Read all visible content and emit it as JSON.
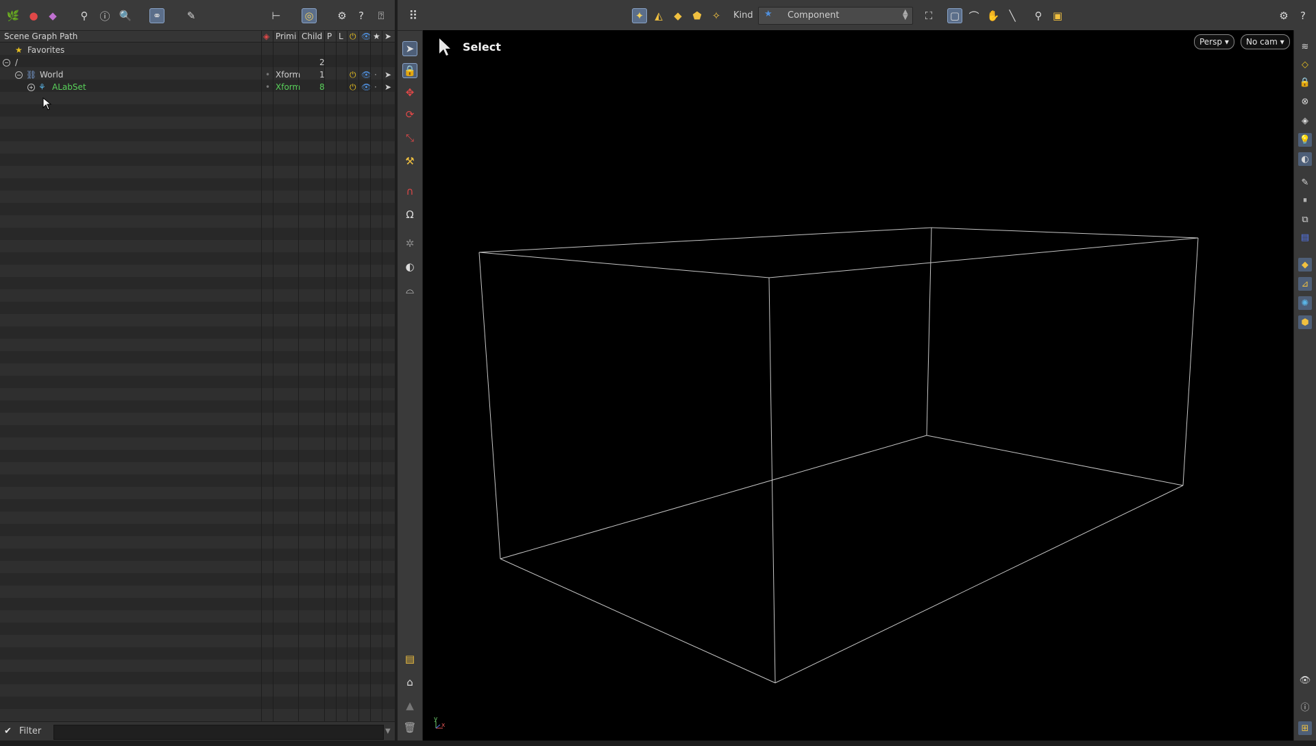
{
  "colors": {
    "accent": "#5b6e8a",
    "green_text": "#59d15a",
    "wire": "#c8c8c8",
    "power": "#e8c020",
    "eye": "#4f8fdc"
  },
  "left_toolbar": {
    "icons": [
      "scene-graph-icon",
      "network-icon",
      "material-icon",
      "lop-tree-icon",
      "info-icon",
      "search-magnifier-icon",
      "link-icon",
      "brush-icon",
      "hierarchy-icon",
      "target-icon",
      "gear-icon",
      "help-book-icon",
      "help-icon"
    ]
  },
  "scene_graph": {
    "columns": {
      "path": "Scene Graph Path",
      "primitive": "Primi",
      "children": "Child",
      "p": "P",
      "l": "L"
    },
    "rows": [
      {
        "name": "Favorites"
      },
      {
        "name": "/",
        "children": "2"
      },
      {
        "name": "World",
        "type": "Xform",
        "children": "1"
      },
      {
        "name": "ALabSet",
        "type": "Xform",
        "children": "8"
      }
    ],
    "filter_label": "Filter"
  },
  "viewport_toolbar": {
    "kind_label": "Kind",
    "kind_value": "Component"
  },
  "viewport": {
    "tool_label": "Select",
    "camera_menu": "Persp",
    "cam_menu": "No cam",
    "axis_y": "y",
    "axis_x": "x"
  }
}
